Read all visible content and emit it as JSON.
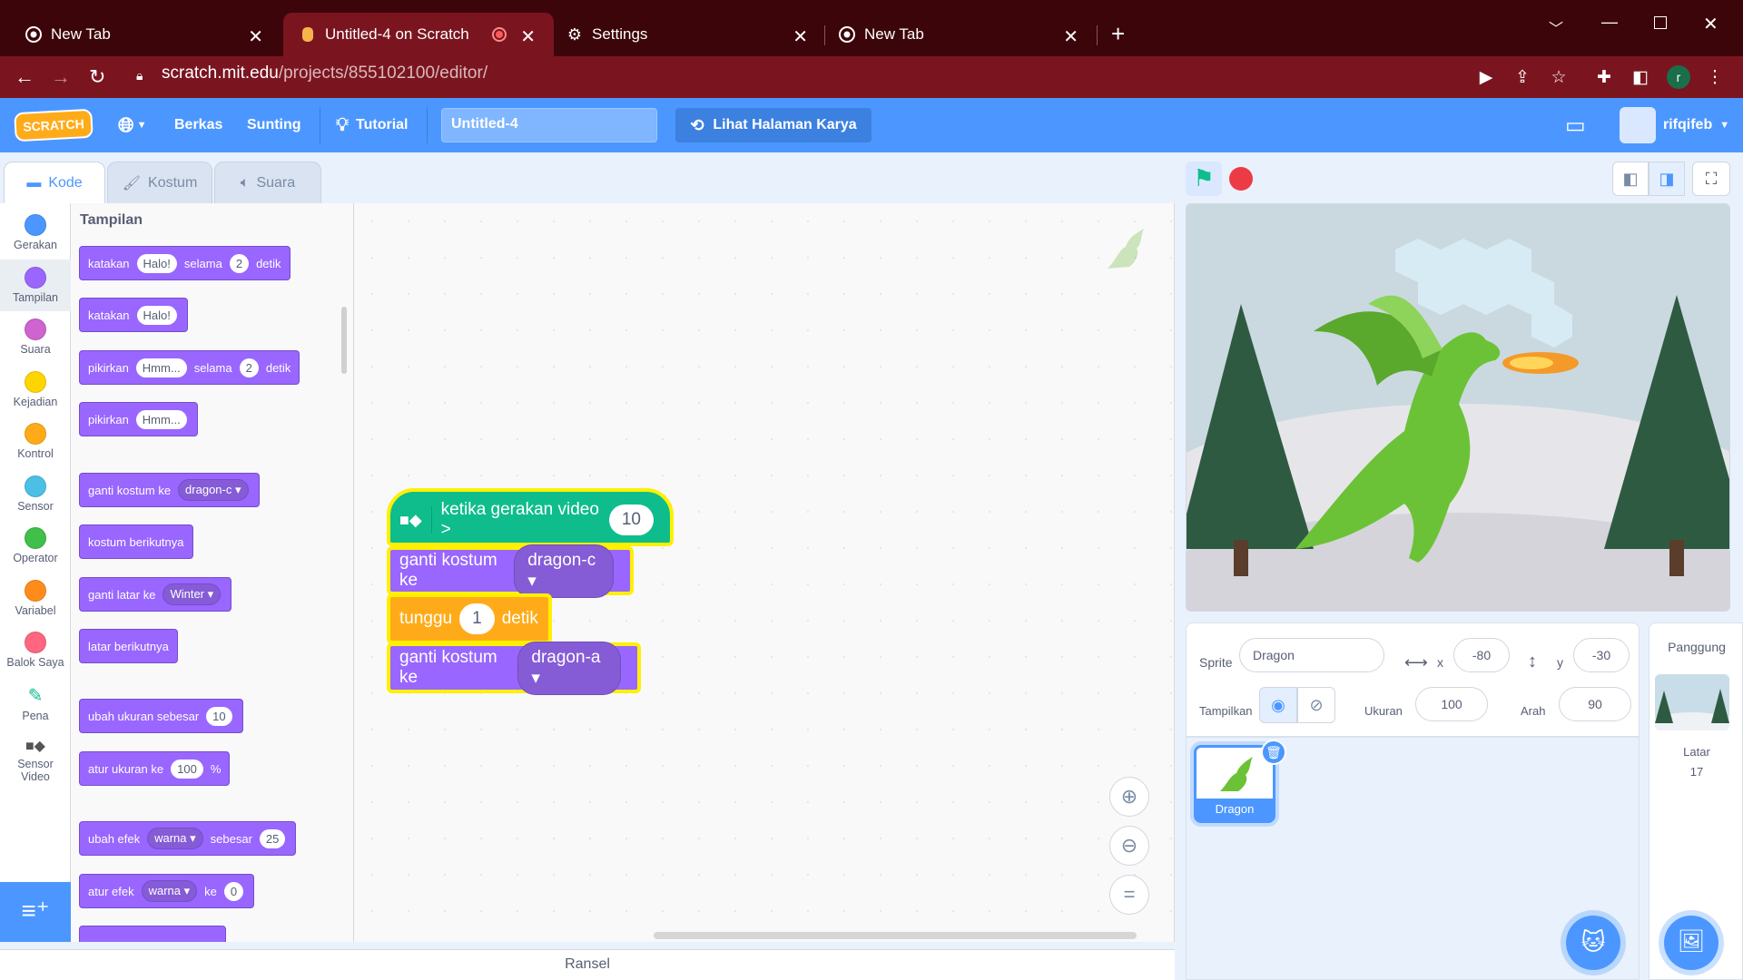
{
  "browser": {
    "tabs": [
      {
        "title": "New Tab",
        "icon": "chrome-icon"
      },
      {
        "title": "Untitled-4 on Scratch",
        "icon": "scratch-favicon"
      },
      {
        "title": "Settings",
        "icon": "gear-icon"
      },
      {
        "title": "New Tab",
        "icon": "chrome-icon"
      }
    ],
    "url_host": "scratch.mit.edu",
    "url_path": "/projects/855102100/editor/",
    "profile_initial": "r"
  },
  "menu": {
    "logo": "SCRATCH",
    "file": "Berkas",
    "edit": "Sunting",
    "tutorial": "Tutorial",
    "project_title": "Untitled-4",
    "see_project": "Lihat Halaman Karya",
    "username": "rifqifeb"
  },
  "editor_tabs": {
    "code": "Kode",
    "costume": "Kostum",
    "sound": "Suara"
  },
  "categories": [
    {
      "label": "Gerakan",
      "color": "#4c97ff"
    },
    {
      "label": "Tampilan",
      "color": "#9966ff"
    },
    {
      "label": "Suara",
      "color": "#cf63cf"
    },
    {
      "label": "Kejadian",
      "color": "#ffd500"
    },
    {
      "label": "Kontrol",
      "color": "#ffab19"
    },
    {
      "label": "Sensor",
      "color": "#4cbfe6"
    },
    {
      "label": "Operator",
      "color": "#40bf4a"
    },
    {
      "label": "Variabel",
      "color": "#ff8c1a"
    },
    {
      "label": "Balok Saya",
      "color": "#ff6680"
    },
    {
      "label": "Pena"
    },
    {
      "label": "Sensor Video"
    }
  ],
  "palette": {
    "heading": "Tampilan",
    "blocks": {
      "say_for": {
        "a": "katakan",
        "msg": "Halo!",
        "b": "selama",
        "secs": "2",
        "c": "detik"
      },
      "say": {
        "a": "katakan",
        "msg": "Halo!"
      },
      "think_for": {
        "a": "pikirkan",
        "msg": "Hmm...",
        "b": "selama",
        "secs": "2",
        "c": "detik"
      },
      "think": {
        "a": "pikirkan",
        "msg": "Hmm..."
      },
      "switch_costume": {
        "a": "ganti kostum ke",
        "val": "dragon-c"
      },
      "next_costume": {
        "a": "kostum berikutnya"
      },
      "switch_backdrop": {
        "a": "ganti latar ke",
        "val": "Winter"
      },
      "next_backdrop": {
        "a": "latar berikutnya"
      },
      "change_size": {
        "a": "ubah ukuran sebesar",
        "val": "10"
      },
      "set_size": {
        "a": "atur ukuran ke",
        "val": "100",
        "b": "%"
      },
      "change_effect": {
        "a": "ubah efek",
        "eff": "warna",
        "b": "sebesar",
        "val": "25"
      },
      "set_effect": {
        "a": "atur efek",
        "eff": "warna",
        "b": "ke",
        "val": "0"
      }
    }
  },
  "script": {
    "hat": {
      "text": "ketika gerakan video >",
      "value": "10"
    },
    "b1": {
      "text": "ganti kostum ke",
      "value": "dragon-c"
    },
    "b2": {
      "text": "tunggu",
      "value": "1",
      "unit": "detik"
    },
    "b3": {
      "text": "ganti kostum ke",
      "value": "dragon-a"
    }
  },
  "backpack": "Ransel",
  "sprite_info": {
    "sprite_label": "Sprite",
    "sprite_name": "Dragon",
    "x_label": "x",
    "x": "-80",
    "y_label": "y",
    "y": "-30",
    "show_label": "Tampilkan",
    "size_label": "Ukuran",
    "size": "100",
    "direction_label": "Arah",
    "direction": "90"
  },
  "sprites": [
    {
      "name": "Dragon"
    }
  ],
  "stage_pane": {
    "title": "Panggung",
    "backdrops_label": "Latar",
    "backdrops_count": "17"
  }
}
